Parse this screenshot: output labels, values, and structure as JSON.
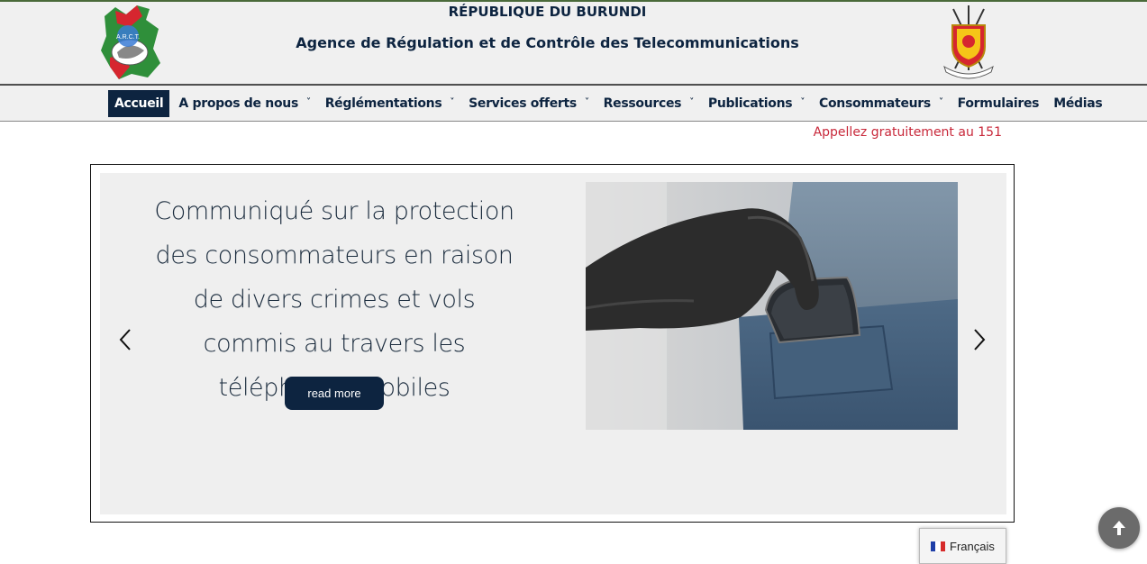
{
  "header": {
    "country": "RÉPUBLIQUE DU BURUNDI",
    "agency": "Agence de Régulation et de Contrôle des Telecommunications",
    "logo_text": "A.R.C.T."
  },
  "nav": {
    "items": [
      {
        "label": "Accueil",
        "dropdown": false,
        "active": true
      },
      {
        "label": "A propos de nous",
        "dropdown": true
      },
      {
        "label": "Réglémentations",
        "dropdown": true
      },
      {
        "label": "Services offerts",
        "dropdown": true
      },
      {
        "label": "Ressources",
        "dropdown": true
      },
      {
        "label": "Publications",
        "dropdown": true
      },
      {
        "label": "Consommateurs",
        "dropdown": true
      },
      {
        "label": "Formulaires",
        "dropdown": false
      },
      {
        "label": "Médias",
        "dropdown": false
      }
    ],
    "chevron": "˅"
  },
  "callfree": "Appellez gratuitement au 151",
  "slider": {
    "title": "Communiqué sur la protection des consommateurs en raison de divers crimes et vols commis au travers les téléphones mobiles",
    "read_more": "read more",
    "prev_icon": "chevron-left-icon",
    "next_icon": "chevron-right-icon"
  },
  "language": {
    "label": "Français",
    "flag": "france-flag-icon"
  },
  "colors": {
    "navy": "#0d2440",
    "accent_red": "#c8283a",
    "header_bg": "#f0f0f0",
    "slide_bg": "#efefef"
  }
}
